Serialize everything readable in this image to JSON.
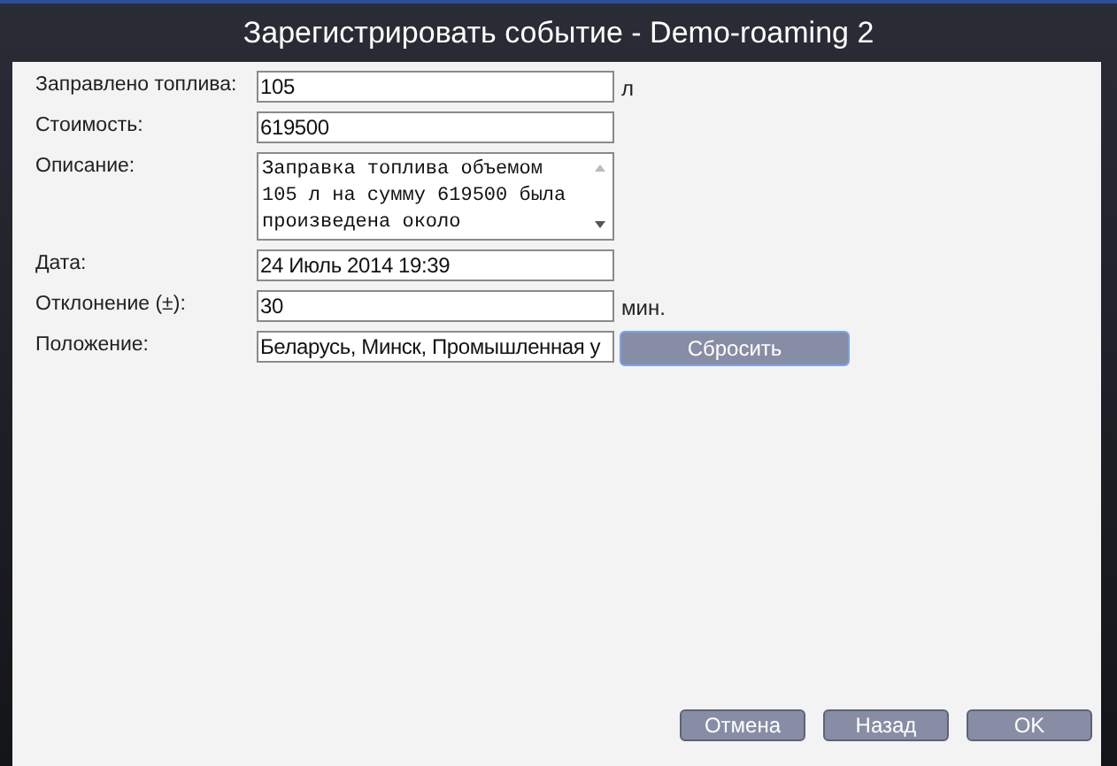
{
  "window": {
    "title": "Зарегистрировать событие - Demo-roaming 2"
  },
  "fields": [
    {
      "kind": "input",
      "label": "Заправлено топлива:",
      "value": "105",
      "unit": "л"
    },
    {
      "kind": "input",
      "label": "Стоимость:",
      "value": "619500"
    },
    {
      "kind": "textarea",
      "label": "Описание:",
      "lines": [
        "Заправка топлива объемом",
        "105 л на сумму 619500 была",
        "произведена около"
      ]
    },
    {
      "kind": "input",
      "label": "Дата:",
      "value": "24 Июль 2014 19:39"
    },
    {
      "kind": "input",
      "label": "Отклонение (±):",
      "value": "30",
      "unit": "мин."
    },
    {
      "kind": "input",
      "label": "Положение:",
      "value": "Беларусь, Минск, Промышленная у",
      "button": "Сбросить"
    }
  ],
  "buttons": [
    "Отмена",
    "Назад",
    "OK"
  ]
}
